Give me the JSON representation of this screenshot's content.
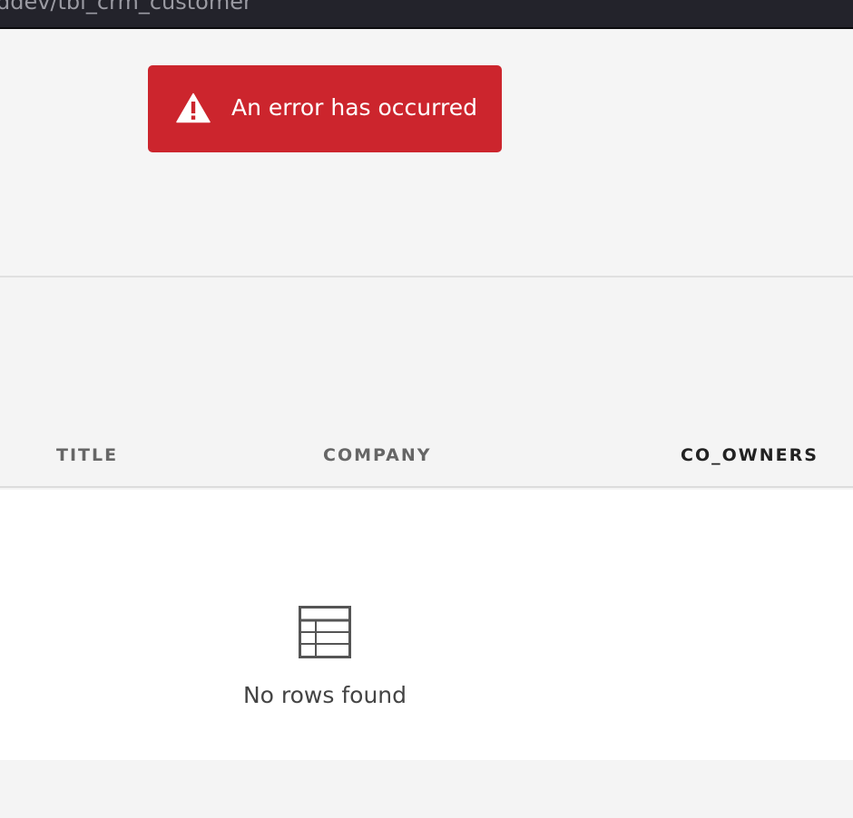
{
  "top_bar": {
    "text": "ddev/tbl_crm_customer"
  },
  "error_banner": {
    "icon": "warning-triangle-icon",
    "message": "An error has occurred",
    "background_color": "#cc252d"
  },
  "table": {
    "columns": [
      "TITLE",
      "COMPANY",
      "CO_OWNERS"
    ],
    "empty_icon": "table-icon",
    "empty_message": "No rows found"
  }
}
